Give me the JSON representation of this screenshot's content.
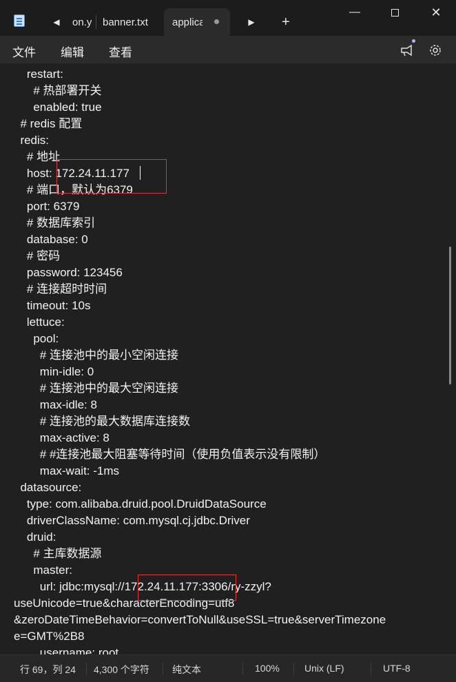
{
  "tabs": [
    {
      "label": "on.y"
    },
    {
      "label": "banner.txt"
    },
    {
      "label": "applica"
    }
  ],
  "menu": [
    "文件",
    "编辑",
    "查看"
  ],
  "lines": [
    "    restart:",
    "      # 热部署开关",
    "      enabled: true",
    "  # redis 配置",
    "  redis:",
    "    # 地址",
    "    host: 172.24.11.177",
    "    # 端口，默认为6379",
    "    port: 6379",
    "    # 数据库索引",
    "    database: 0",
    "    # 密码",
    "    password: 123456",
    "    # 连接超时时间",
    "    timeout: 10s",
    "    lettuce:",
    "      pool:",
    "        # 连接池中的最小空闲连接",
    "        min-idle: 0",
    "        # 连接池中的最大空闲连接",
    "        max-idle: 8",
    "        # 连接池的最大数据库连接数",
    "        max-active: 8",
    "        # #连接池最大阻塞等待时间（使用负值表示没有限制）",
    "        max-wait: -1ms",
    "  datasource:",
    "    type: com.alibaba.druid.pool.DruidDataSource",
    "    driverClassName: com.mysql.cj.jdbc.Driver",
    "    druid:",
    "      # 主库数据源",
    "      master:",
    "        url: jdbc:mysql://172.24.11.177:3306/ry-zzyl?",
    "useUnicode=true&characterEncoding=utf8",
    "&zeroDateTimeBehavior=convertToNull&useSSL=true&serverTimezone",
    "e=GMT%2B8",
    "        username: root"
  ],
  "status": {
    "position": "行 69，列 24",
    "chars": "4,300 个字符",
    "format": "纯文本",
    "zoom": "100%",
    "eol": "Unix (LF)",
    "encoding": "UTF-8"
  },
  "highlight_color": "#e0333a"
}
